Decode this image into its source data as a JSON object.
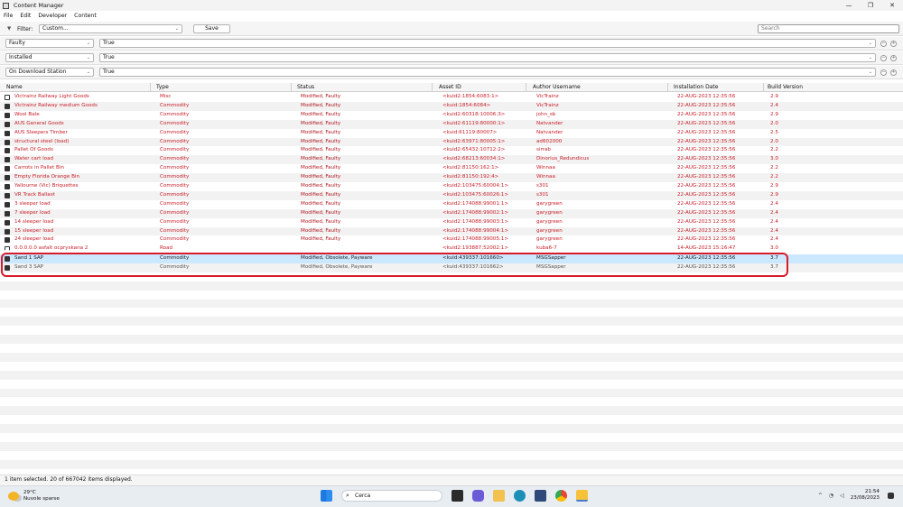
{
  "window": {
    "title": "Content Manager",
    "controls": [
      "—",
      "❐",
      "✕"
    ]
  },
  "menu": [
    "File",
    "Edit",
    "Developer",
    "Content"
  ],
  "filter": {
    "label": "Filter:",
    "selected": "Custom...",
    "save_label": "Save",
    "search_placeholder": "Search"
  },
  "conditions": [
    {
      "field": "Faulty",
      "value": "True"
    },
    {
      "field": "Installed",
      "value": "True"
    },
    {
      "field": "On Download Station",
      "value": "True"
    }
  ],
  "columns": [
    "Name",
    "Type",
    "Status",
    "Asset ID",
    "Author Username",
    "Installation Date",
    "Build Version"
  ],
  "rows": [
    {
      "name": "Victrainz Railway Light Goods",
      "type": "Misc",
      "status": "Modified, Faulty",
      "asset_id": "<kuid2:1854:6083:1>",
      "author": "VicTrainz",
      "date": "22-AUG-2023 12:35:56",
      "build": "2.9"
    },
    {
      "name": "Victrainz Railway medium Goods",
      "type": "Commodity",
      "status": "Modified, Faulty",
      "asset_id": "<kuid:1854:6084>",
      "author": "VicTrainz",
      "date": "22-AUG-2023 12:35:56",
      "build": "2.4"
    },
    {
      "name": "Wool Bale",
      "type": "Commodity",
      "status": "Modified, Faulty",
      "asset_id": "<kuid2:60318:10006:3>",
      "author": "john_sb",
      "date": "22-AUG-2023 12:35:56",
      "build": "2.9"
    },
    {
      "name": "AUS General Goods",
      "type": "Commodity",
      "status": "Modified, Faulty",
      "asset_id": "<kuid2:61119:80000:1>",
      "author": "Natvander",
      "date": "22-AUG-2023 12:35:56",
      "build": "2.0"
    },
    {
      "name": "AUS Sleepers Timber",
      "type": "Commodity",
      "status": "Modified, Faulty",
      "asset_id": "<kuid:61119:80007>",
      "author": "Natvander",
      "date": "22-AUG-2023 12:35:56",
      "build": "2.5"
    },
    {
      "name": "structural steel (load)",
      "type": "Commodity",
      "status": "Modified, Faulty",
      "asset_id": "<kuid2:63971:80005:1>",
      "author": "ad602000",
      "date": "22-AUG-2023 12:35:56",
      "build": "2.0"
    },
    {
      "name": "Pallet Of Goods",
      "type": "Commodity",
      "status": "Modified, Faulty",
      "asset_id": "<kuid2:65432:10712:2>",
      "author": "sirrab",
      "date": "22-AUG-2023 12:35:56",
      "build": "2.2"
    },
    {
      "name": "Water cart load",
      "type": "Commodity",
      "status": "Modified, Faulty",
      "asset_id": "<kuid2:68213:60034:1>",
      "author": "Dinorius_Redundicus",
      "date": "22-AUG-2023 12:35:56",
      "build": "3.0"
    },
    {
      "name": "Carrots in Pallet Bin",
      "type": "Commodity",
      "status": "Modified, Faulty",
      "asset_id": "<kuid2:81150:162:1>",
      "author": "Winnaa",
      "date": "22-AUG-2023 12:35:56",
      "build": "2.2"
    },
    {
      "name": "Empty Florida Orange Bin",
      "type": "Commodity",
      "status": "Modified, Faulty",
      "asset_id": "<kuid2:81150:192:4>",
      "author": "Winnaa",
      "date": "22-AUG-2023 12:35:56",
      "build": "2.2"
    },
    {
      "name": "Yallourne (Vic) Briquettes",
      "type": "Commodity",
      "status": "Modified, Faulty",
      "asset_id": "<kuid2:103475:60004:1>",
      "author": "s301",
      "date": "22-AUG-2023 12:35:56",
      "build": "2.9"
    },
    {
      "name": "VR Track Ballast",
      "type": "Commodity",
      "status": "Modified, Faulty",
      "asset_id": "<kuid2:103475:60026:1>",
      "author": "s301",
      "date": "22-AUG-2023 12:35:56",
      "build": "2.9"
    },
    {
      "name": "3 sleeper load",
      "type": "Commodity",
      "status": "Modified, Faulty",
      "asset_id": "<kuid2:174088:99001:1>",
      "author": "garygreen",
      "date": "22-AUG-2023 12:35:56",
      "build": "2.4"
    },
    {
      "name": "7 sleeper load",
      "type": "Commodity",
      "status": "Modified, Faulty",
      "asset_id": "<kuid2:174088:99002:1>",
      "author": "garygreen",
      "date": "22-AUG-2023 12:35:56",
      "build": "2.4"
    },
    {
      "name": "14 sleeper load",
      "type": "Commodity",
      "status": "Modified, Faulty",
      "asset_id": "<kuid2:174088:99003:1>",
      "author": "garygreen",
      "date": "22-AUG-2023 12:35:56",
      "build": "2.4"
    },
    {
      "name": "15 sleeper load",
      "type": "Commodity",
      "status": "Modified, Faulty",
      "asset_id": "<kuid2:174088:99004:1>",
      "author": "garygreen",
      "date": "22-AUG-2023 12:35:56",
      "build": "2.4"
    },
    {
      "name": "24 sleeper load",
      "type": "Commodity",
      "status": "Modified, Faulty",
      "asset_id": "<kuid2:174088:99005:1>",
      "author": "garygreen",
      "date": "22-AUG-2023 12:35:56",
      "build": "2.4"
    }
  ],
  "partial_row": {
    "name": "0.0.0.0.0 asfalt ocpryskana 2",
    "type": "Road",
    "status": "",
    "asset_id": "<kuid2:193887:52002:1>",
    "author": "kuba6-7",
    "date": "14-AUG-2023 15:16:47",
    "build": "3.0"
  },
  "selected_rows": [
    {
      "name": "Sand 1 SAP",
      "type": "Commodity",
      "status": "Modified, Obsolete, Payware",
      "asset_id": "<kuid:439337:101660>",
      "author": "MSGSapper",
      "date": "22-AUG-2023 12:35:56",
      "build": "3.7"
    },
    {
      "name": "Sand 3 SAP",
      "type": "Commodity",
      "status": "Modified, Obsolete, Payware",
      "asset_id": "<kuid:439337:101662>",
      "author": "MSGSapper",
      "date": "22-AUG-2023 12:35:56",
      "build": "3.7"
    }
  ],
  "status_bar": "1 item selected. 20 of 667042 items displayed.",
  "taskbar": {
    "weather_temp": "29°C",
    "weather_desc": "Nuvole sparse",
    "search_label": "Cerca",
    "time": "21:54",
    "date": "23/08/2023",
    "tray_chevron": "^",
    "apps": [
      "start-icon",
      "task-view-icon",
      "chat-icon",
      "file-explorer-icon",
      "edge-icon",
      "store-icon",
      "chrome-icon",
      "content-manager-icon"
    ]
  },
  "colors": {
    "faulty": "#c8202a",
    "selection": "#cce8ff",
    "highlight": "#d71b2b"
  }
}
